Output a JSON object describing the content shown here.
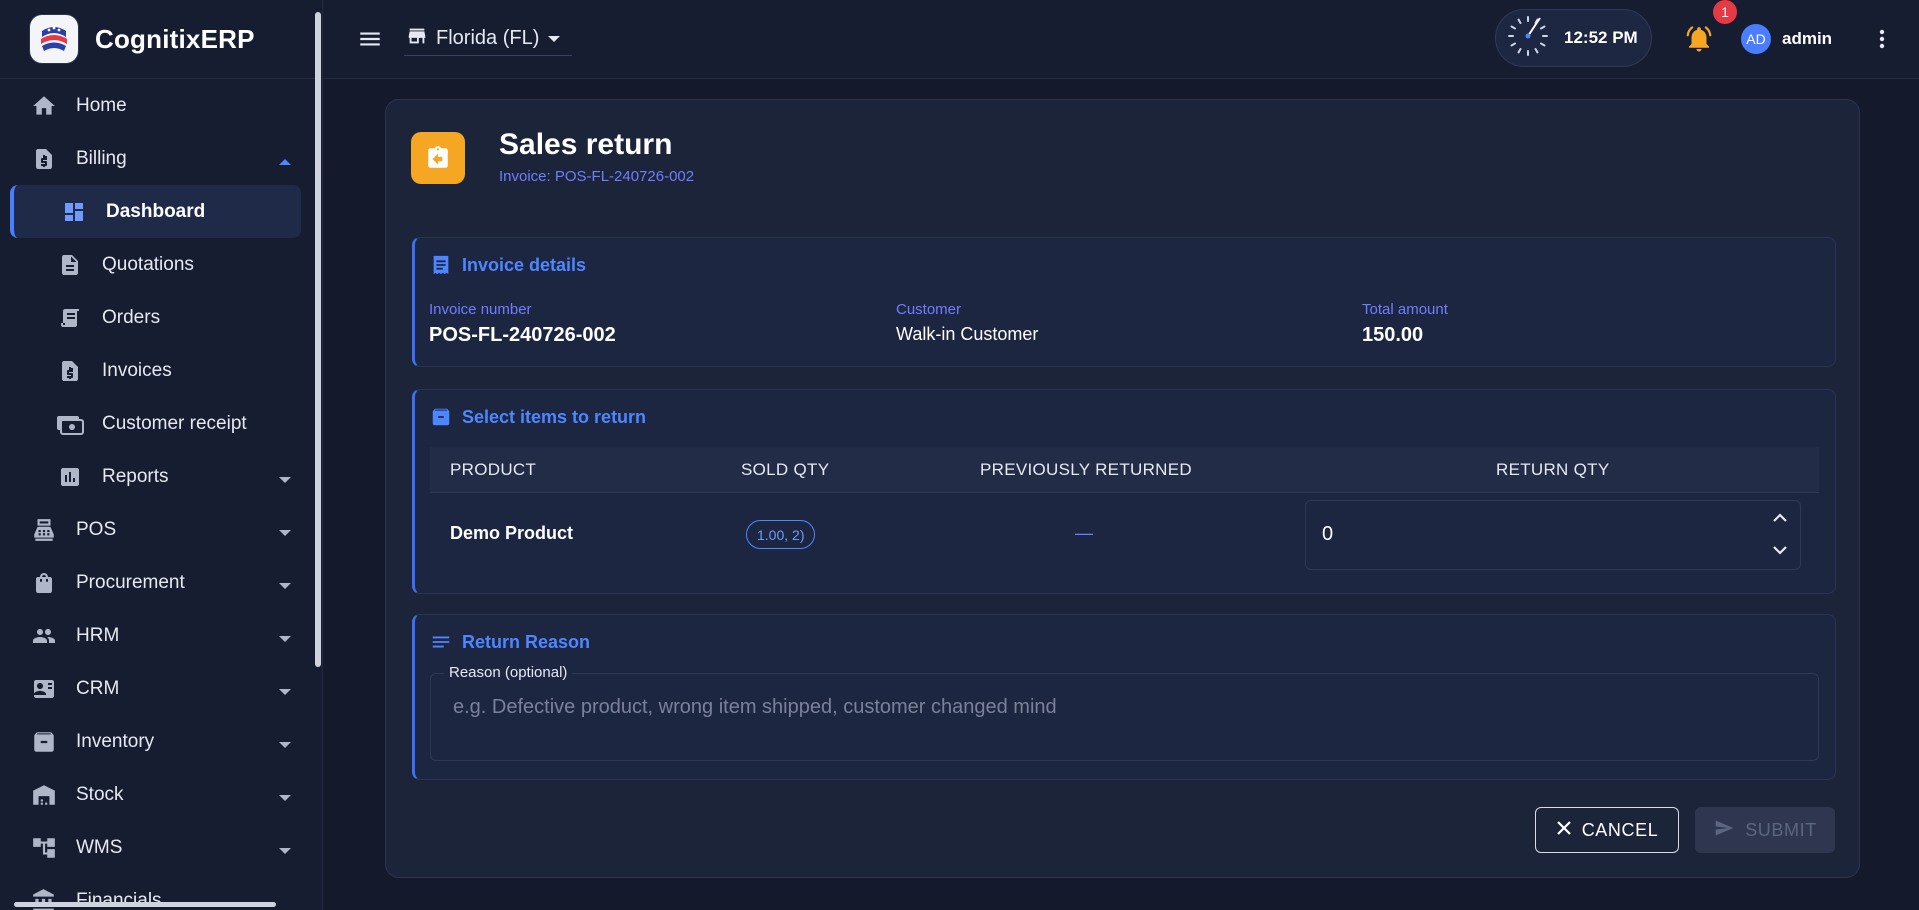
{
  "brand": {
    "name": "CognitixERP"
  },
  "sidebar": {
    "items": [
      {
        "label": "Home",
        "icon": "home-icon"
      },
      {
        "label": "Billing",
        "icon": "billing-icon",
        "expanded": true
      },
      {
        "label": "Dashboard",
        "icon": "dashboard-icon",
        "active": true
      },
      {
        "label": "Quotations",
        "icon": "document-icon"
      },
      {
        "label": "Orders",
        "icon": "receipt-icon"
      },
      {
        "label": "Invoices",
        "icon": "invoice-icon"
      },
      {
        "label": "Customer receipt",
        "icon": "payments-icon"
      },
      {
        "label": "Reports",
        "icon": "bar-chart-icon"
      },
      {
        "label": "POS",
        "icon": "cash-register-icon"
      },
      {
        "label": "Procurement",
        "icon": "shopping-bag-icon"
      },
      {
        "label": "HRM",
        "icon": "people-icon"
      },
      {
        "label": "CRM",
        "icon": "contact-card-icon"
      },
      {
        "label": "Inventory",
        "icon": "archive-icon"
      },
      {
        "label": "Stock",
        "icon": "warehouse-icon"
      },
      {
        "label": "WMS",
        "icon": "hierarchy-icon"
      },
      {
        "label": "Financials",
        "icon": "bank-icon"
      }
    ]
  },
  "topbar": {
    "store": "Florida (FL)",
    "time": "12:52 PM",
    "notification_count": "1",
    "user_initials": "AD",
    "user_name": "admin"
  },
  "page": {
    "title": "Sales return",
    "subtitle": "Invoice: POS-FL-240726-002"
  },
  "invoice_details": {
    "heading": "Invoice details",
    "invoice_number_label": "Invoice number",
    "invoice_number": "POS-FL-240726-002",
    "customer_label": "Customer",
    "customer": "Walk-in Customer",
    "total_label": "Total amount",
    "total": "150.00"
  },
  "items": {
    "heading": "Select items to return",
    "columns": [
      "PRODUCT",
      "SOLD QTY",
      "PREVIOUSLY RETURNED",
      "RETURN QTY"
    ],
    "rows": [
      {
        "product": "Demo Product",
        "sold_qty": "1.00, 2)",
        "previously_returned": "—",
        "return_qty": "0"
      }
    ]
  },
  "reason": {
    "heading": "Return Reason",
    "label": "Reason (optional)",
    "placeholder": "e.g. Defective product, wrong item shipped, customer changed mind"
  },
  "actions": {
    "cancel": "CANCEL",
    "submit": "SUBMIT"
  },
  "colors": {
    "accent": "#4e86ff",
    "orange": "#f5a623",
    "danger": "#e53945",
    "background": "#141a2c",
    "card": "#1c2439"
  }
}
